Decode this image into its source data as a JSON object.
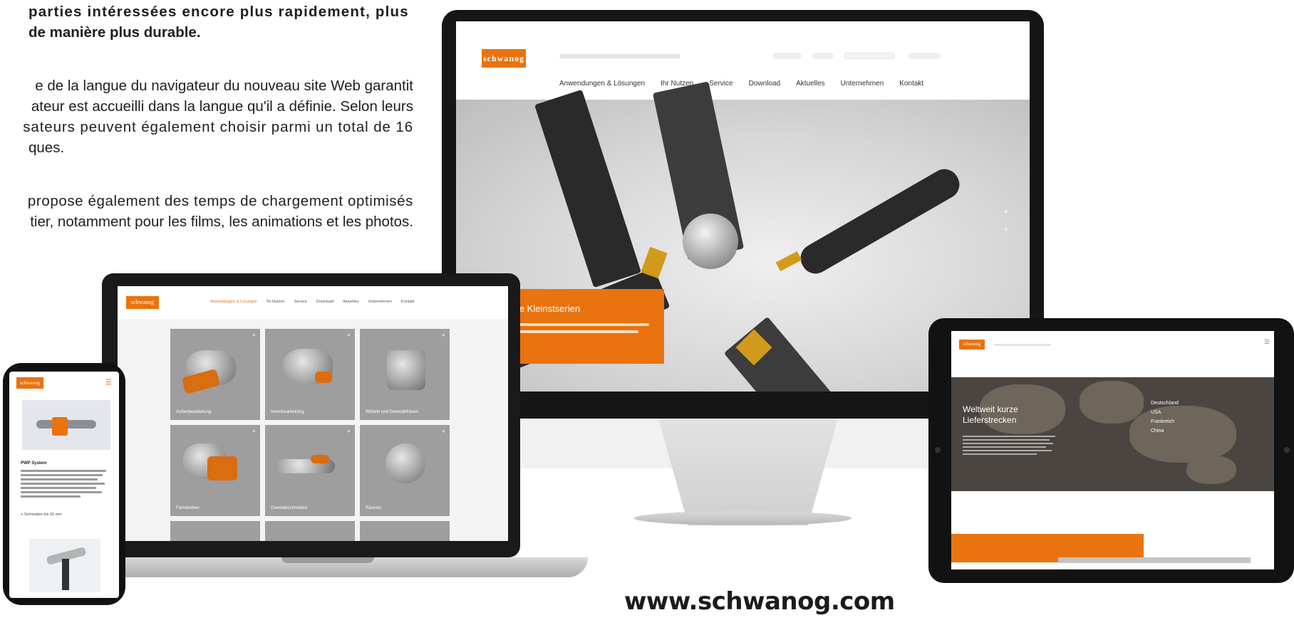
{
  "article": {
    "lead_line_1": "parties intéressées encore plus rapidement, plus",
    "lead_line_2": "de manière plus durable.",
    "para2_line_1": "e de la langue du navigateur du nouveau site Web garantit",
    "para2_line_2": "ateur est accueilli dans la langue qu'il a définie. Selon leurs",
    "para2_line_3": "sateurs peuvent également choisir parmi un total de 16",
    "para2_line_4": "ques.",
    "para3_line_1": "propose également des temps de chargement optimisés",
    "para3_line_2": "tier, notamment pour les films, les animations et les photos."
  },
  "monitor": {
    "logo": "schwanog",
    "nav": [
      "Anwendungen & Lösungen",
      "Ihr Nutzen",
      "Service",
      "Download",
      "Aktuelles",
      "Unternehmen",
      "Kontakt"
    ],
    "banner_title": "Individuelle Kleinstserien"
  },
  "laptop": {
    "logo": "schwanog",
    "cards": [
      {
        "label": "Außenbearbeitung"
      },
      {
        "label": "Innenbearbeitung"
      },
      {
        "label": "Wirbeln und Gewindefräsen"
      },
      {
        "label": "Formdrehen"
      },
      {
        "label": "Gewindeschneiden"
      },
      {
        "label": "Räumen"
      }
    ],
    "plus_icon": "plus-icon",
    "accent": "#e8730f"
  },
  "phone": {
    "logo": "schwanog",
    "title": "PWP System",
    "bullet": "Schneiden bis 16 mm",
    "menu_icon": "hamburger-menu-icon"
  },
  "tablet": {
    "logo": "schwanog",
    "headline": "Weltweit kurze Lieferstrecken",
    "countries": [
      "Deutschland",
      "USA",
      "Frankreich",
      "China"
    ]
  },
  "caption": {
    "url": "www.schwanog.com"
  }
}
